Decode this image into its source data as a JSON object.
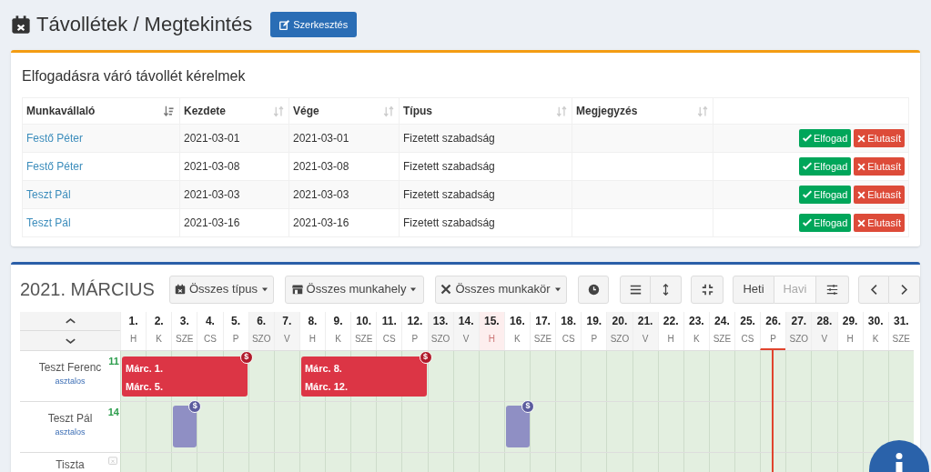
{
  "page_title": "Távollétek / Megtekintés",
  "edit_button": "Szerkesztés",
  "pending": {
    "title": "Elfogadásra váró távollét kérelmek",
    "columns": [
      {
        "label": "Munkavállaló",
        "sorted": true
      },
      {
        "label": "Kezdete",
        "sorted": false
      },
      {
        "label": "Vége",
        "sorted": false
      },
      {
        "label": "Típus",
        "sorted": false
      },
      {
        "label": "Megjegyzés",
        "sorted": false
      }
    ],
    "rows": [
      {
        "employee": "Festő Péter",
        "start": "2021-03-01",
        "end": "2021-03-01",
        "type": "Fizetett szabadság",
        "accept": "Elfogad",
        "reject": "Elutasít"
      },
      {
        "employee": "Festő Péter",
        "start": "2021-03-08",
        "end": "2021-03-08",
        "type": "Fizetett szabadság",
        "accept": "Elfogad",
        "reject": "Elutasít"
      },
      {
        "employee": "Teszt Pál",
        "start": "2021-03-03",
        "end": "2021-03-03",
        "type": "Fizetett szabadság",
        "accept": "Elfogad",
        "reject": "Elutasít"
      },
      {
        "employee": "Teszt Pál",
        "start": "2021-03-16",
        "end": "2021-03-16",
        "type": "Fizetett szabadság",
        "accept": "Elfogad",
        "reject": "Elutasít"
      }
    ]
  },
  "calendar": {
    "month_title": "2021. MÁRCIUS",
    "filters": [
      {
        "kind": "type",
        "label": "Összes típus"
      },
      {
        "kind": "workplace",
        "label": "Összes munkahely"
      },
      {
        "kind": "role",
        "label": "Összes munkakör"
      }
    ],
    "view_tabs": [
      {
        "label": "Heti",
        "selected": true
      },
      {
        "label": "Havi",
        "selected": false
      }
    ],
    "days": [
      {
        "day": "1.",
        "weekday": "H",
        "kind": "workday",
        "today": false
      },
      {
        "day": "2.",
        "weekday": "K",
        "kind": "workday",
        "today": false
      },
      {
        "day": "3.",
        "weekday": "SZE",
        "kind": "workday",
        "today": false
      },
      {
        "day": "4.",
        "weekday": "CS",
        "kind": "workday",
        "today": false
      },
      {
        "day": "5.",
        "weekday": "P",
        "kind": "workday",
        "today": false
      },
      {
        "day": "6.",
        "weekday": "SZO",
        "kind": "weekend",
        "today": false
      },
      {
        "day": "7.",
        "weekday": "V",
        "kind": "weekend",
        "today": false
      },
      {
        "day": "8.",
        "weekday": "H",
        "kind": "workday",
        "today": false
      },
      {
        "day": "9.",
        "weekday": "K",
        "kind": "workday",
        "today": false
      },
      {
        "day": "10.",
        "weekday": "SZE",
        "kind": "workday",
        "today": false
      },
      {
        "day": "11.",
        "weekday": "CS",
        "kind": "workday",
        "today": false
      },
      {
        "day": "12.",
        "weekday": "P",
        "kind": "workday",
        "today": false
      },
      {
        "day": "13.",
        "weekday": "SZO",
        "kind": "weekend",
        "today": false
      },
      {
        "day": "14.",
        "weekday": "V",
        "kind": "weekend",
        "today": false
      },
      {
        "day": "15.",
        "weekday": "H",
        "kind": "holiday",
        "today": false
      },
      {
        "day": "16.",
        "weekday": "K",
        "kind": "workday",
        "today": false
      },
      {
        "day": "17.",
        "weekday": "SZE",
        "kind": "workday",
        "today": false
      },
      {
        "day": "18.",
        "weekday": "CS",
        "kind": "workday",
        "today": false
      },
      {
        "day": "19.",
        "weekday": "P",
        "kind": "workday",
        "today": false
      },
      {
        "day": "20.",
        "weekday": "SZO",
        "kind": "weekend",
        "today": false
      },
      {
        "day": "21.",
        "weekday": "V",
        "kind": "weekend",
        "today": false
      },
      {
        "day": "22.",
        "weekday": "H",
        "kind": "workday",
        "today": false
      },
      {
        "day": "23.",
        "weekday": "K",
        "kind": "workday",
        "today": false
      },
      {
        "day": "24.",
        "weekday": "SZE",
        "kind": "workday",
        "today": false
      },
      {
        "day": "25.",
        "weekday": "CS",
        "kind": "workday",
        "today": false
      },
      {
        "day": "26.",
        "weekday": "P",
        "kind": "workday",
        "today": true
      },
      {
        "day": "27.",
        "weekday": "SZO",
        "kind": "weekend",
        "today": false
      },
      {
        "day": "28.",
        "weekday": "V",
        "kind": "weekend",
        "today": false
      },
      {
        "day": "29.",
        "weekday": "H",
        "kind": "workday",
        "today": false
      },
      {
        "day": "30.",
        "weekday": "K",
        "kind": "workday",
        "today": false
      },
      {
        "day": "31.",
        "weekday": "SZE",
        "kind": "workday",
        "today": false
      }
    ],
    "employees": [
      {
        "name": "Teszt Ferenc",
        "role": "asztalos",
        "count": "11",
        "days": [
          {
            "absent": true
          },
          {
            "absent": true
          },
          {
            "absent": true
          },
          {
            "absent": true
          },
          {
            "absent": true
          },
          {
            "absent": false
          },
          {
            "absent": false
          },
          {
            "absent": true
          },
          {
            "absent": true
          },
          {
            "absent": true
          },
          {
            "absent": true
          },
          {
            "absent": true
          },
          {
            "absent": false
          },
          {
            "absent": false
          },
          {
            "absent": false
          },
          {
            "absent": false
          },
          {
            "absent": false
          },
          {
            "absent": false
          },
          {
            "absent": false
          },
          {
            "absent": false
          },
          {
            "absent": false
          },
          {
            "absent": false
          },
          {
            "absent": false
          },
          {
            "absent": false
          },
          {
            "absent": false
          },
          {
            "absent": false
          },
          {
            "absent": false
          },
          {
            "absent": false
          },
          {
            "absent": false
          },
          {
            "absent": false
          },
          {
            "absent": false
          }
        ],
        "absences": [
          {
            "kind": "approved",
            "color": "#dc3545",
            "labels": [
              "Márc. 1.",
              "Márc. 5."
            ],
            "badge": "$"
          },
          {
            "kind": "approved",
            "color": "#dc3545",
            "labels": [
              "Márc. 8.",
              "Márc. 12."
            ],
            "badge": "$"
          }
        ]
      },
      {
        "name": "Teszt Pál",
        "role": "asztalos",
        "count": "14",
        "days": [
          {
            "absent": false
          },
          {
            "absent": false
          },
          {
            "absent": true
          },
          {
            "absent": false
          },
          {
            "absent": false
          },
          {
            "absent": false
          },
          {
            "absent": false
          },
          {
            "absent": false
          },
          {
            "absent": false
          },
          {
            "absent": false
          },
          {
            "absent": false
          },
          {
            "absent": false
          },
          {
            "absent": false
          },
          {
            "absent": false
          },
          {
            "absent": false
          },
          {
            "absent": true
          },
          {
            "absent": false
          },
          {
            "absent": false
          },
          {
            "absent": false
          },
          {
            "absent": false
          },
          {
            "absent": false
          },
          {
            "absent": false
          },
          {
            "absent": false
          },
          {
            "absent": false
          },
          {
            "absent": false
          },
          {
            "absent": false
          },
          {
            "absent": false
          },
          {
            "absent": false
          },
          {
            "absent": false
          },
          {
            "absent": false
          },
          {
            "absent": false
          }
        ],
        "absences": [
          {
            "kind": "pending",
            "color": "#8f8fc4",
            "badge": "$"
          },
          {
            "kind": "pending",
            "color": "#8f8fc4",
            "badge": "$"
          }
        ]
      },
      {
        "name": "Tiszta",
        "no_absence": true
      }
    ]
  }
}
